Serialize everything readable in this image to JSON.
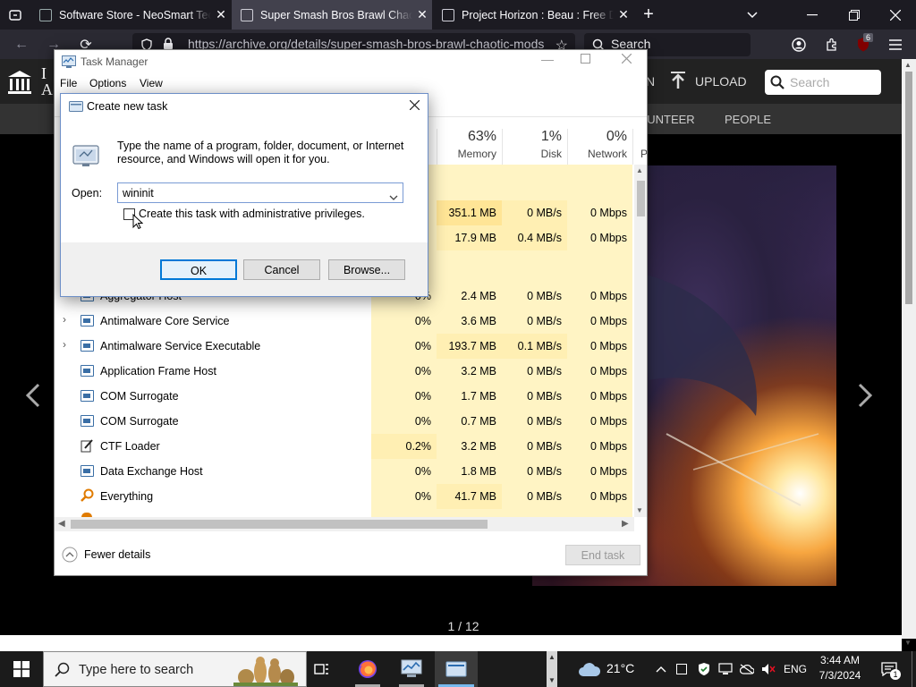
{
  "browser": {
    "tabs": [
      {
        "title": "Software Store - NeoSmart Techno",
        "close": "✕"
      },
      {
        "title": "Super Smash Bros Brawl Chaotic",
        "close": "✕"
      },
      {
        "title": "Project Horizon : Beau : Free Do",
        "close": "✕"
      }
    ],
    "new_tab": "+",
    "url": "https://archive.org/details/super-smash-bros-brawl-chaotic-mods",
    "search_placeholder": "Search",
    "extension_badge": "6"
  },
  "archive": {
    "logo_initials": "I",
    "logo_initials2": "A",
    "upload_label": "UPLOAD",
    "search_placeholder": "Search",
    "nav_partial": "N",
    "nav": [
      "LUNTEER",
      "PEOPLE"
    ],
    "pager": "1 / 12"
  },
  "task_manager": {
    "title": "Task Manager",
    "menu": [
      "File",
      "Options",
      "View"
    ],
    "columns": [
      {
        "percent": "63%",
        "name": "Memory"
      },
      {
        "percent": "1%",
        "name": "Disk"
      },
      {
        "percent": "0%",
        "name": "Network"
      },
      {
        "percent": "",
        "name": "P"
      }
    ],
    "partial_rows": [
      {
        "cpu": "",
        "memory": "351.1 MB",
        "disk": "0 MB/s",
        "network": "0 Mbps"
      },
      {
        "cpu": "",
        "memory": "17.9 MB",
        "disk": "0.4 MB/s",
        "network": "0 Mbps"
      }
    ],
    "processes": [
      {
        "name": "Aggregator Host",
        "cpu": "0%",
        "memory": "2.4 MB",
        "disk": "0 MB/s",
        "network": "0 Mbps",
        "expandable": false
      },
      {
        "name": "Antimalware Core Service",
        "cpu": "0%",
        "memory": "3.6 MB",
        "disk": "0 MB/s",
        "network": "0 Mbps",
        "expandable": true
      },
      {
        "name": "Antimalware Service Executable",
        "cpu": "0%",
        "memory": "193.7 MB",
        "disk": "0.1 MB/s",
        "network": "0 Mbps",
        "expandable": true
      },
      {
        "name": "Application Frame Host",
        "cpu": "0%",
        "memory": "3.2 MB",
        "disk": "0 MB/s",
        "network": "0 Mbps",
        "expandable": false
      },
      {
        "name": "COM Surrogate",
        "cpu": "0%",
        "memory": "1.7 MB",
        "disk": "0 MB/s",
        "network": "0 Mbps",
        "expandable": false
      },
      {
        "name": "COM Surrogate",
        "cpu": "0%",
        "memory": "0.7 MB",
        "disk": "0 MB/s",
        "network": "0 Mbps",
        "expandable": false
      },
      {
        "name": "CTF Loader",
        "cpu": "0.2%",
        "memory": "3.2 MB",
        "disk": "0 MB/s",
        "network": "0 Mbps",
        "expandable": false
      },
      {
        "name": "Data Exchange Host",
        "cpu": "0%",
        "memory": "1.8 MB",
        "disk": "0 MB/s",
        "network": "0 Mbps",
        "expandable": false
      },
      {
        "name": "Everything",
        "cpu": "0%",
        "memory": "41.7 MB",
        "disk": "0 MB/s",
        "network": "0 Mbps",
        "expandable": false
      }
    ],
    "fewer_details": "Fewer details",
    "end_task": "End task"
  },
  "dialog": {
    "title": "Create new task",
    "description": "Type the name of a program, folder, document, or Internet resource, and Windows will open it for you.",
    "open_label": "Open:",
    "open_value": "wininit",
    "admin_checkbox_label": "Create this task with administrative privileges.",
    "admin_checked": false,
    "ok": "OK",
    "cancel": "Cancel",
    "browse": "Browse..."
  },
  "taskbar": {
    "search_placeholder": "Type here to search",
    "temperature": "21°C",
    "language": "ENG",
    "time": "3:44 AM",
    "date": "7/3/2024",
    "notification_count": "1"
  },
  "colors": {
    "cpu_highlight": "#fff4c4",
    "memory_highlight": "#ffe596",
    "dialog_button_focus": "#0078d7",
    "firefox_dark": "#1c1b22",
    "ublock_red": "#800000"
  }
}
